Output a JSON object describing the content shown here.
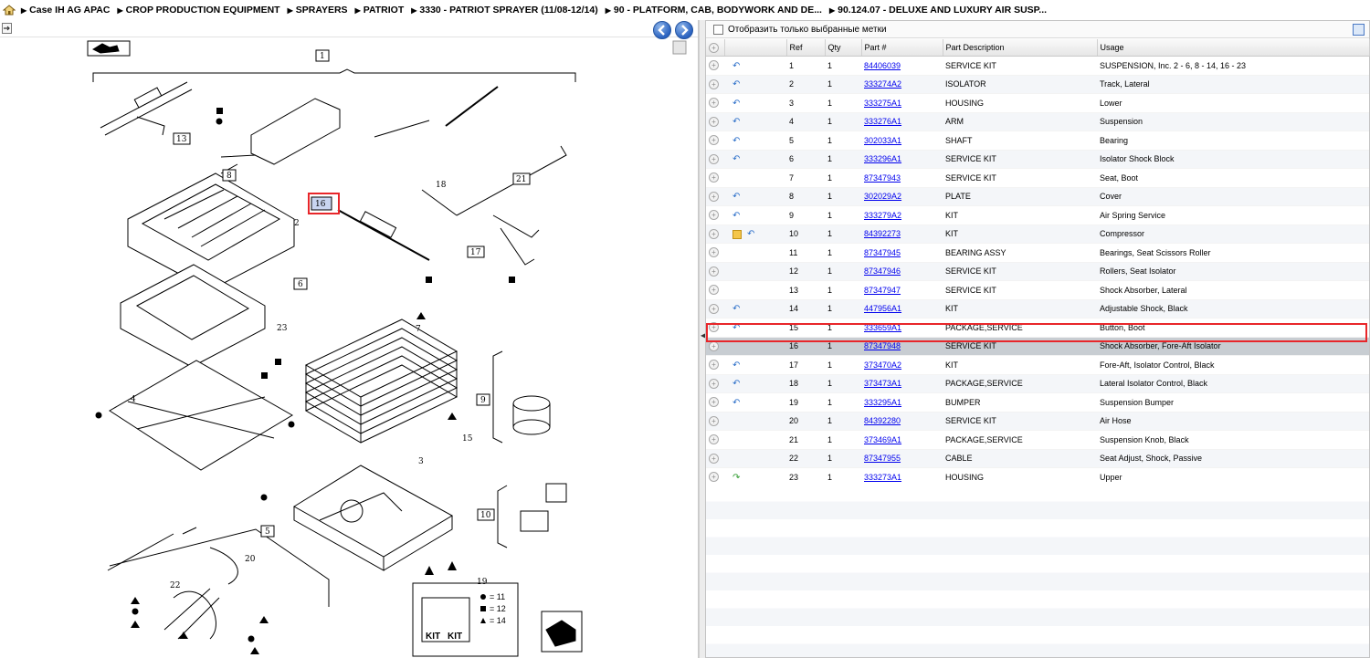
{
  "breadcrumb": {
    "items": [
      {
        "label": "Case IH AG APAC"
      },
      {
        "label": "CROP PRODUCTION EQUIPMENT"
      },
      {
        "label": "SPRAYERS"
      },
      {
        "label": "PATRIOT"
      },
      {
        "label": "3330 - PATRIOT SPRAYER (11/08-12/14)"
      },
      {
        "label": "90 - PLATFORM, CAB, BODYWORK AND DE..."
      },
      {
        "label": "90.124.07 - DELUXE AND LUXURY AIR SUSP..."
      }
    ]
  },
  "filter": {
    "label": "Отобразить только выбранные метки"
  },
  "table": {
    "columns": [
      "Ref",
      "Qty",
      "Part #",
      "Part Description",
      "Usage"
    ],
    "selected_ref": "16",
    "rows": [
      {
        "icon": "return-icon",
        "ref": "1",
        "qty": "1",
        "part": "84406039",
        "desc": "SERVICE KIT",
        "usage": "SUSPENSION, Inc. 2 - 6, 8 - 14, 16 - 23"
      },
      {
        "icon": "return-icon",
        "ref": "2",
        "qty": "1",
        "part": "333274A2",
        "desc": "ISOLATOR",
        "usage": "Track, Lateral"
      },
      {
        "icon": "return-icon",
        "ref": "3",
        "qty": "1",
        "part": "333275A1",
        "desc": "HOUSING",
        "usage": "Lower"
      },
      {
        "icon": "return-icon",
        "ref": "4",
        "qty": "1",
        "part": "333276A1",
        "desc": "ARM",
        "usage": "Suspension"
      },
      {
        "icon": "return-icon",
        "ref": "5",
        "qty": "1",
        "part": "302033A1",
        "desc": "SHAFT",
        "usage": "Bearing"
      },
      {
        "icon": "return-icon",
        "ref": "6",
        "qty": "1",
        "part": "333296A1",
        "desc": "SERVICE KIT",
        "usage": "Isolator Shock Block"
      },
      {
        "icon": "",
        "ref": "7",
        "qty": "1",
        "part": "87347943",
        "desc": "SERVICE KIT",
        "usage": "Seat, Boot"
      },
      {
        "icon": "return-icon",
        "ref": "8",
        "qty": "1",
        "part": "302029A2",
        "desc": "PLATE",
        "usage": "Cover"
      },
      {
        "icon": "return-icon",
        "ref": "9",
        "qty": "1",
        "part": "333279A2",
        "desc": "KIT",
        "usage": "Air Spring Service"
      },
      {
        "icon": "note-return-icon",
        "ref": "10",
        "qty": "1",
        "part": "84392273",
        "desc": "KIT",
        "usage": "Compressor"
      },
      {
        "icon": "",
        "ref": "11",
        "qty": "1",
        "part": "87347945",
        "desc": "BEARING ASSY",
        "usage": "Bearings, Seat Scissors Roller"
      },
      {
        "icon": "",
        "ref": "12",
        "qty": "1",
        "part": "87347946",
        "desc": "SERVICE KIT",
        "usage": "Rollers, Seat Isolator"
      },
      {
        "icon": "",
        "ref": "13",
        "qty": "1",
        "part": "87347947",
        "desc": "SERVICE KIT",
        "usage": "Shock Absorber, Lateral"
      },
      {
        "icon": "return-icon",
        "ref": "14",
        "qty": "1",
        "part": "447956A1",
        "desc": "KIT",
        "usage": "Adjustable Shock, Black"
      },
      {
        "icon": "return-icon",
        "ref": "15",
        "qty": "1",
        "part": "333659A1",
        "desc": "PACKAGE,SERVICE",
        "usage": "Button, Boot"
      },
      {
        "icon": "",
        "ref": "16",
        "qty": "1",
        "part": "87347948",
        "desc": "SERVICE KIT",
        "usage": "Shock Absorber, Fore-Aft Isolator"
      },
      {
        "icon": "return-icon",
        "ref": "17",
        "qty": "1",
        "part": "373470A2",
        "desc": "KIT",
        "usage": "Fore-Aft, Isolator Control, Black"
      },
      {
        "icon": "return-icon",
        "ref": "18",
        "qty": "1",
        "part": "373473A1",
        "desc": "PACKAGE,SERVICE",
        "usage": "Lateral Isolator Control, Black"
      },
      {
        "icon": "return-icon",
        "ref": "19",
        "qty": "1",
        "part": "333295A1",
        "desc": "BUMPER",
        "usage": "Suspension Bumper"
      },
      {
        "icon": "",
        "ref": "20",
        "qty": "1",
        "part": "84392280",
        "desc": "SERVICE KIT",
        "usage": "Air Hose"
      },
      {
        "icon": "",
        "ref": "21",
        "qty": "1",
        "part": "373469A1",
        "desc": "PACKAGE,SERVICE",
        "usage": "Suspension Knob, Black"
      },
      {
        "icon": "",
        "ref": "22",
        "qty": "1",
        "part": "87347955",
        "desc": "CABLE",
        "usage": "Seat Adjust, Shock, Passive"
      },
      {
        "icon": "forward-icon",
        "ref": "23",
        "qty": "1",
        "part": "333273A1",
        "desc": "HOUSING",
        "usage": "Upper"
      }
    ]
  },
  "diagram": {
    "callouts": [
      "1",
      "2",
      "3",
      "4",
      "5",
      "6",
      "7",
      "8",
      "9",
      "10",
      "11",
      "12",
      "13",
      "14",
      "15",
      "16",
      "17",
      "18",
      "19",
      "20",
      "21",
      "22",
      "23"
    ],
    "selected_callout": "16",
    "legend": {
      "circle": "= 11",
      "square": "= 12",
      "triangle": "= 14",
      "kit_label": "KIT"
    }
  },
  "colors": {
    "link": "#0000ee",
    "selection_outline": "#e8262a",
    "selected_row": "#c8cdd2",
    "nav_button": "#2a62c0"
  }
}
